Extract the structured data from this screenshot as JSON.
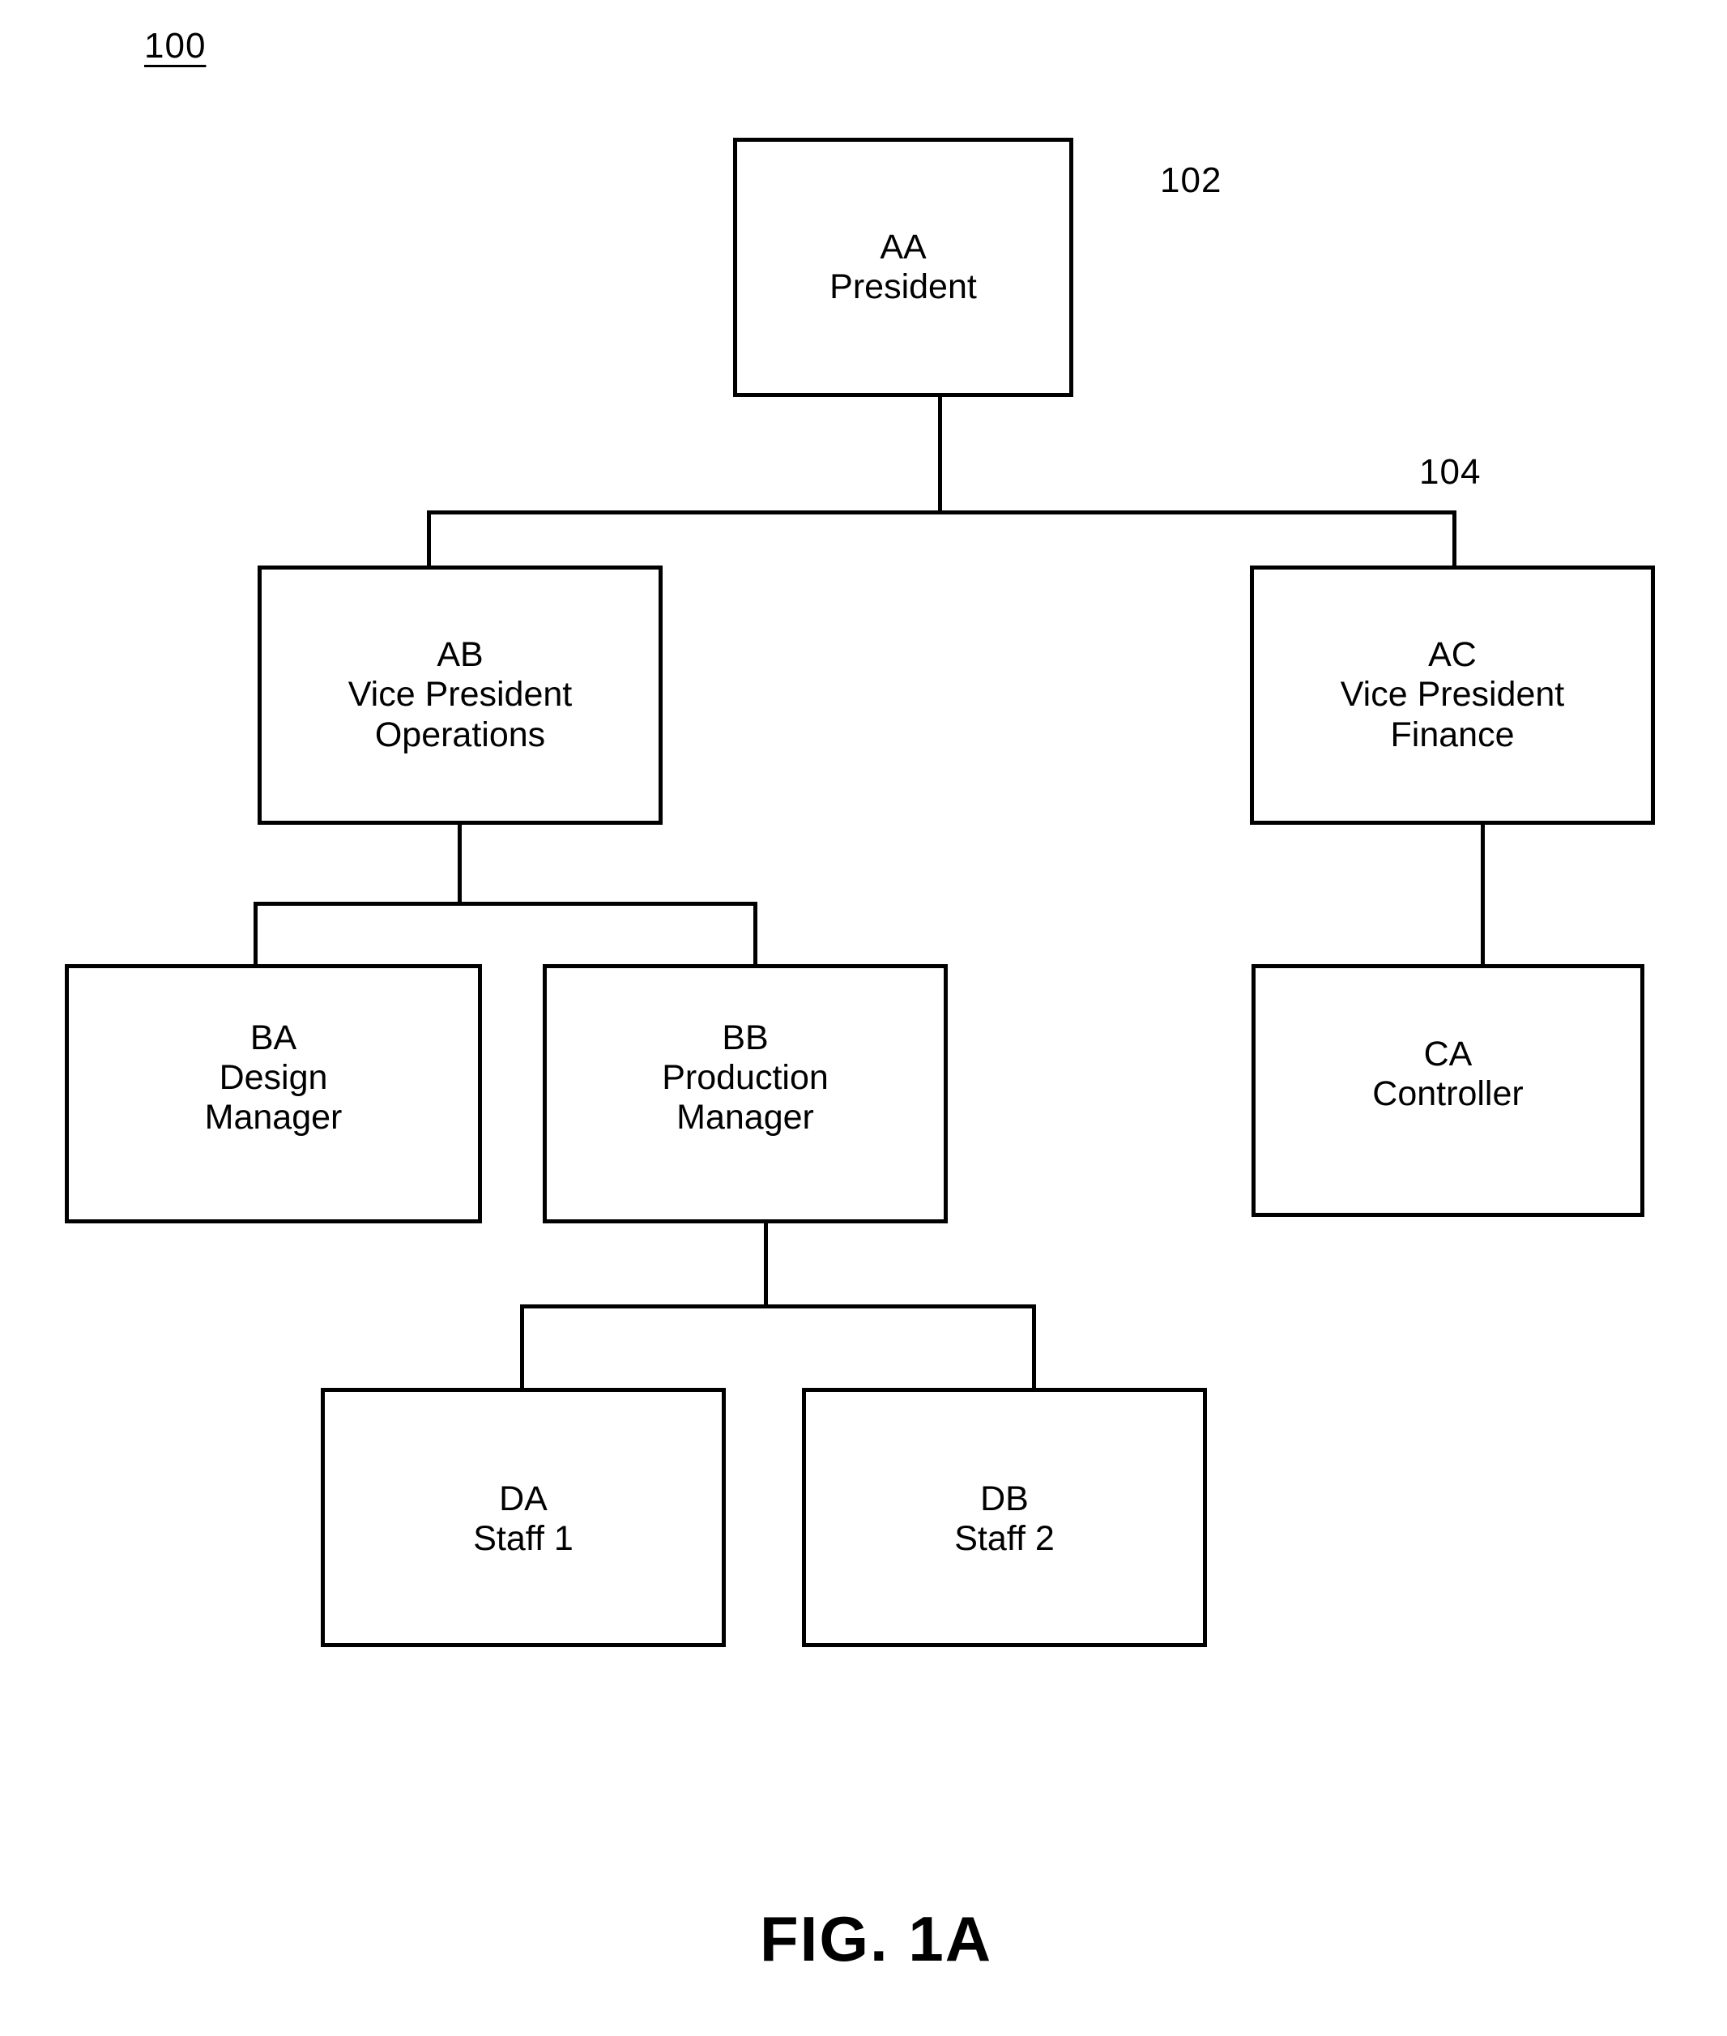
{
  "figure": {
    "reference_number": "100",
    "caption": "FIG. 1A"
  },
  "callouts": [
    {
      "id": "callout-102",
      "label": "102",
      "points_to": "AA President box"
    },
    {
      "id": "callout-104",
      "label": "104",
      "points_to": "vice president connector bus"
    }
  ],
  "chart_data": {
    "type": "diagram",
    "subtype": "organization-chart",
    "title": "FIG. 1A",
    "reference_number": "100",
    "nodes": [
      {
        "id": "AA",
        "code": "AA",
        "lines": [
          "AA",
          "President"
        ],
        "level": 0,
        "parent": null
      },
      {
        "id": "AB",
        "code": "AB",
        "lines": [
          "AB",
          "Vice President",
          "Operations"
        ],
        "level": 1,
        "parent": "AA"
      },
      {
        "id": "AC",
        "code": "AC",
        "lines": [
          "AC",
          "Vice President",
          "Finance"
        ],
        "level": 1,
        "parent": "AA"
      },
      {
        "id": "BA",
        "code": "BA",
        "lines": [
          "BA",
          "Design",
          "Manager"
        ],
        "level": 2,
        "parent": "AB"
      },
      {
        "id": "BB",
        "code": "BB",
        "lines": [
          "BB",
          "Production",
          "Manager"
        ],
        "level": 2,
        "parent": "AB"
      },
      {
        "id": "CA",
        "code": "CA",
        "lines": [
          "CA",
          "Controller"
        ],
        "level": 2,
        "parent": "AC"
      },
      {
        "id": "DA",
        "code": "DA",
        "lines": [
          "DA",
          "Staff 1"
        ],
        "level": 3,
        "parent": "BB"
      },
      {
        "id": "DB",
        "code": "DB",
        "lines": [
          "DB",
          "Staff 2"
        ],
        "level": 3,
        "parent": "BB"
      }
    ],
    "edges": [
      {
        "from": "AA",
        "to": "AB"
      },
      {
        "from": "AA",
        "to": "AC"
      },
      {
        "from": "AB",
        "to": "BA"
      },
      {
        "from": "AB",
        "to": "BB"
      },
      {
        "from": "AC",
        "to": "CA"
      },
      {
        "from": "BB",
        "to": "DA"
      },
      {
        "from": "BB",
        "to": "DB"
      }
    ],
    "annotations": [
      {
        "label": "102",
        "target": "AA"
      },
      {
        "label": "104",
        "target": "AA-to-vice-presidents-connector"
      }
    ],
    "colors": {
      "line": "#000000",
      "background": "#ffffff",
      "text": "#000000"
    }
  },
  "nodes": {
    "AA": {
      "line1": "AA",
      "line2": "President"
    },
    "AB": {
      "line1": "AB",
      "line2": "Vice President",
      "line3": "Operations"
    },
    "AC": {
      "line1": "AC",
      "line2": "Vice President",
      "line3": "Finance"
    },
    "BA": {
      "line1": "BA",
      "line2": "Design",
      "line3": "Manager"
    },
    "BB": {
      "line1": "BB",
      "line2": "Production",
      "line3": "Manager"
    },
    "CA": {
      "line1": "CA",
      "line2": "Controller"
    },
    "DA": {
      "line1": "DA",
      "line2": "Staff 1"
    },
    "DB": {
      "line1": "DB",
      "line2": "Staff 2"
    }
  }
}
